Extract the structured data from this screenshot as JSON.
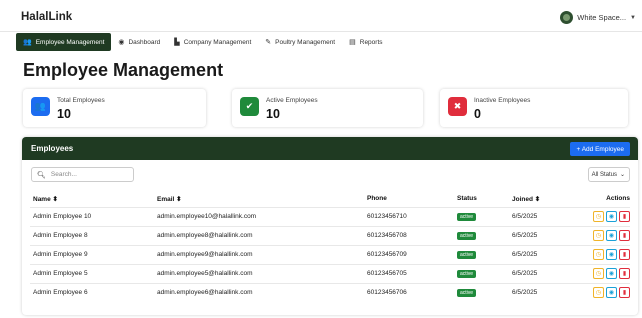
{
  "app": {
    "brand": "HalalLink",
    "user_name": "White Space..."
  },
  "nav": {
    "items": [
      {
        "label": "Employee Management",
        "icon": "users-icon",
        "glyph": "👥"
      },
      {
        "label": "Dashboard",
        "icon": "dashboard-icon",
        "glyph": "◉"
      },
      {
        "label": "Company Management",
        "icon": "building-icon",
        "glyph": "▙"
      },
      {
        "label": "Poultry Management",
        "icon": "feather-icon",
        "glyph": "✎"
      },
      {
        "label": "Reports",
        "icon": "chart-icon",
        "glyph": "▤"
      }
    ]
  },
  "page": {
    "title": "Employee Management"
  },
  "stats": [
    {
      "label": "Total Employees",
      "value": "10",
      "color": "#1c6cf0",
      "glyph": "👥"
    },
    {
      "label": "Active Employees",
      "value": "10",
      "color": "#1f8a3b",
      "glyph": "✔"
    },
    {
      "label": "Inactive Employees",
      "value": "0",
      "color": "#e02d3c",
      "glyph": "✖"
    }
  ],
  "panel": {
    "title": "Employees",
    "add_label": "+ Add Employee",
    "search_placeholder": "Search...",
    "status_filter": "All Status"
  },
  "table": {
    "headers": {
      "name": "Name ⬍",
      "email": "Email ⬍",
      "phone": "Phone",
      "status": "Status",
      "joined": "Joined ⬍",
      "actions": "Actions"
    },
    "rows": [
      {
        "name": "Admin Employee 10",
        "email": "admin.employee10@halallink.com",
        "phone": "60123456710",
        "status": "active",
        "joined": "6/5/2025"
      },
      {
        "name": "Admin Employee 8",
        "email": "admin.employee8@halallink.com",
        "phone": "60123456708",
        "status": "active",
        "joined": "6/5/2025"
      },
      {
        "name": "Admin Employee 9",
        "email": "admin.employee9@halallink.com",
        "phone": "60123456709",
        "status": "active",
        "joined": "6/5/2025"
      },
      {
        "name": "Admin Employee 5",
        "email": "admin.employee5@halallink.com",
        "phone": "60123456705",
        "status": "active",
        "joined": "6/5/2025"
      },
      {
        "name": "Admin Employee 6",
        "email": "admin.employee6@halallink.com",
        "phone": "60123456706",
        "status": "active",
        "joined": "6/5/2025"
      }
    ]
  }
}
